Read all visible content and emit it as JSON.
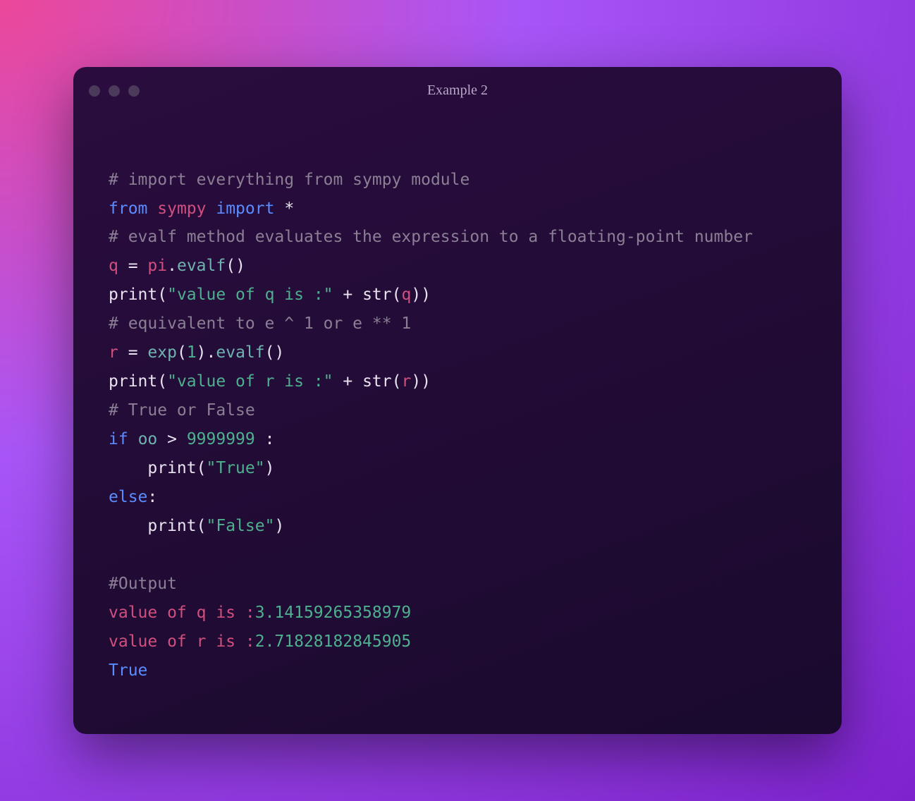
{
  "window": {
    "title": "Example 2"
  },
  "code": {
    "c1": "# import everything from sympy module",
    "kw_from": "from",
    "mod_sympy": "sympy",
    "kw_import": "import",
    "star": "*",
    "c2": "# evalf method evaluates the expression to a floating-point number",
    "var_q": "q",
    "eq": " = ",
    "pi": "pi",
    "dot": ".",
    "evalf": "evalf",
    "lp": "(",
    "rp": ")",
    "print": "print",
    "str_q": "\"value of q is :\"",
    "plus": " + ",
    "strfn": "str",
    "c3": "# equivalent to e ^ 1 or e ** 1",
    "var_r": "r",
    "exp": "exp",
    "one": "1",
    "str_r": "\"value of r is :\"",
    "c4": "# True or False",
    "kw_if": "if",
    "oo": "oo",
    "gt": " > ",
    "bignum": "9999999",
    "colon": " :",
    "colon2": ":",
    "indent": "    ",
    "str_true": "\"True\"",
    "kw_else": "else",
    "str_false": "\"False\"",
    "c5": "#Output",
    "out1a": "value of q is :",
    "out1b": "3.14159265358979",
    "out2a": "value of r is :",
    "out2b": "2.71828182845905",
    "out3": "True"
  }
}
